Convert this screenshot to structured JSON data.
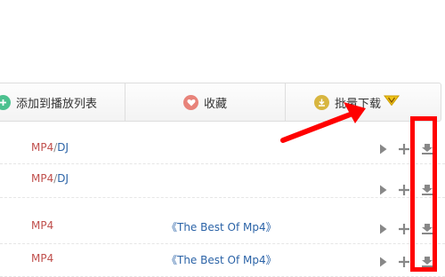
{
  "toolbar": {
    "add_to_playlist": "添加到播放列表",
    "favorite": "收藏",
    "batch_download": "批量下载"
  },
  "songs": [
    {
      "format_main": "MP4",
      "separator": "/",
      "format_extra": "DJ",
      "album": ""
    },
    {
      "format_main": "MP4",
      "separator": "/",
      "format_extra": "DJ",
      "album": ""
    },
    {
      "format_main": "MP4",
      "separator": "",
      "format_extra": "",
      "album": "《The Best Of Mp4》"
    },
    {
      "format_main": "MP4",
      "separator": "",
      "format_extra": "",
      "album": "《The Best Of Mp4》"
    }
  ],
  "icons": {
    "add_to_playlist": "plus-circle-icon",
    "favorite": "heart-icon",
    "batch_download": "download-circle-icon",
    "vip": "vip-diamond-icon",
    "play": "play-icon",
    "add": "plus-icon",
    "download": "download-icon"
  },
  "colors": {
    "add_icon": "#4cc18f",
    "favorite_icon": "#e8837a",
    "download_icon": "#d8b640",
    "format_red": "#c0504d",
    "link_blue": "#2b63a7",
    "annotation_red": "#ff0000"
  }
}
